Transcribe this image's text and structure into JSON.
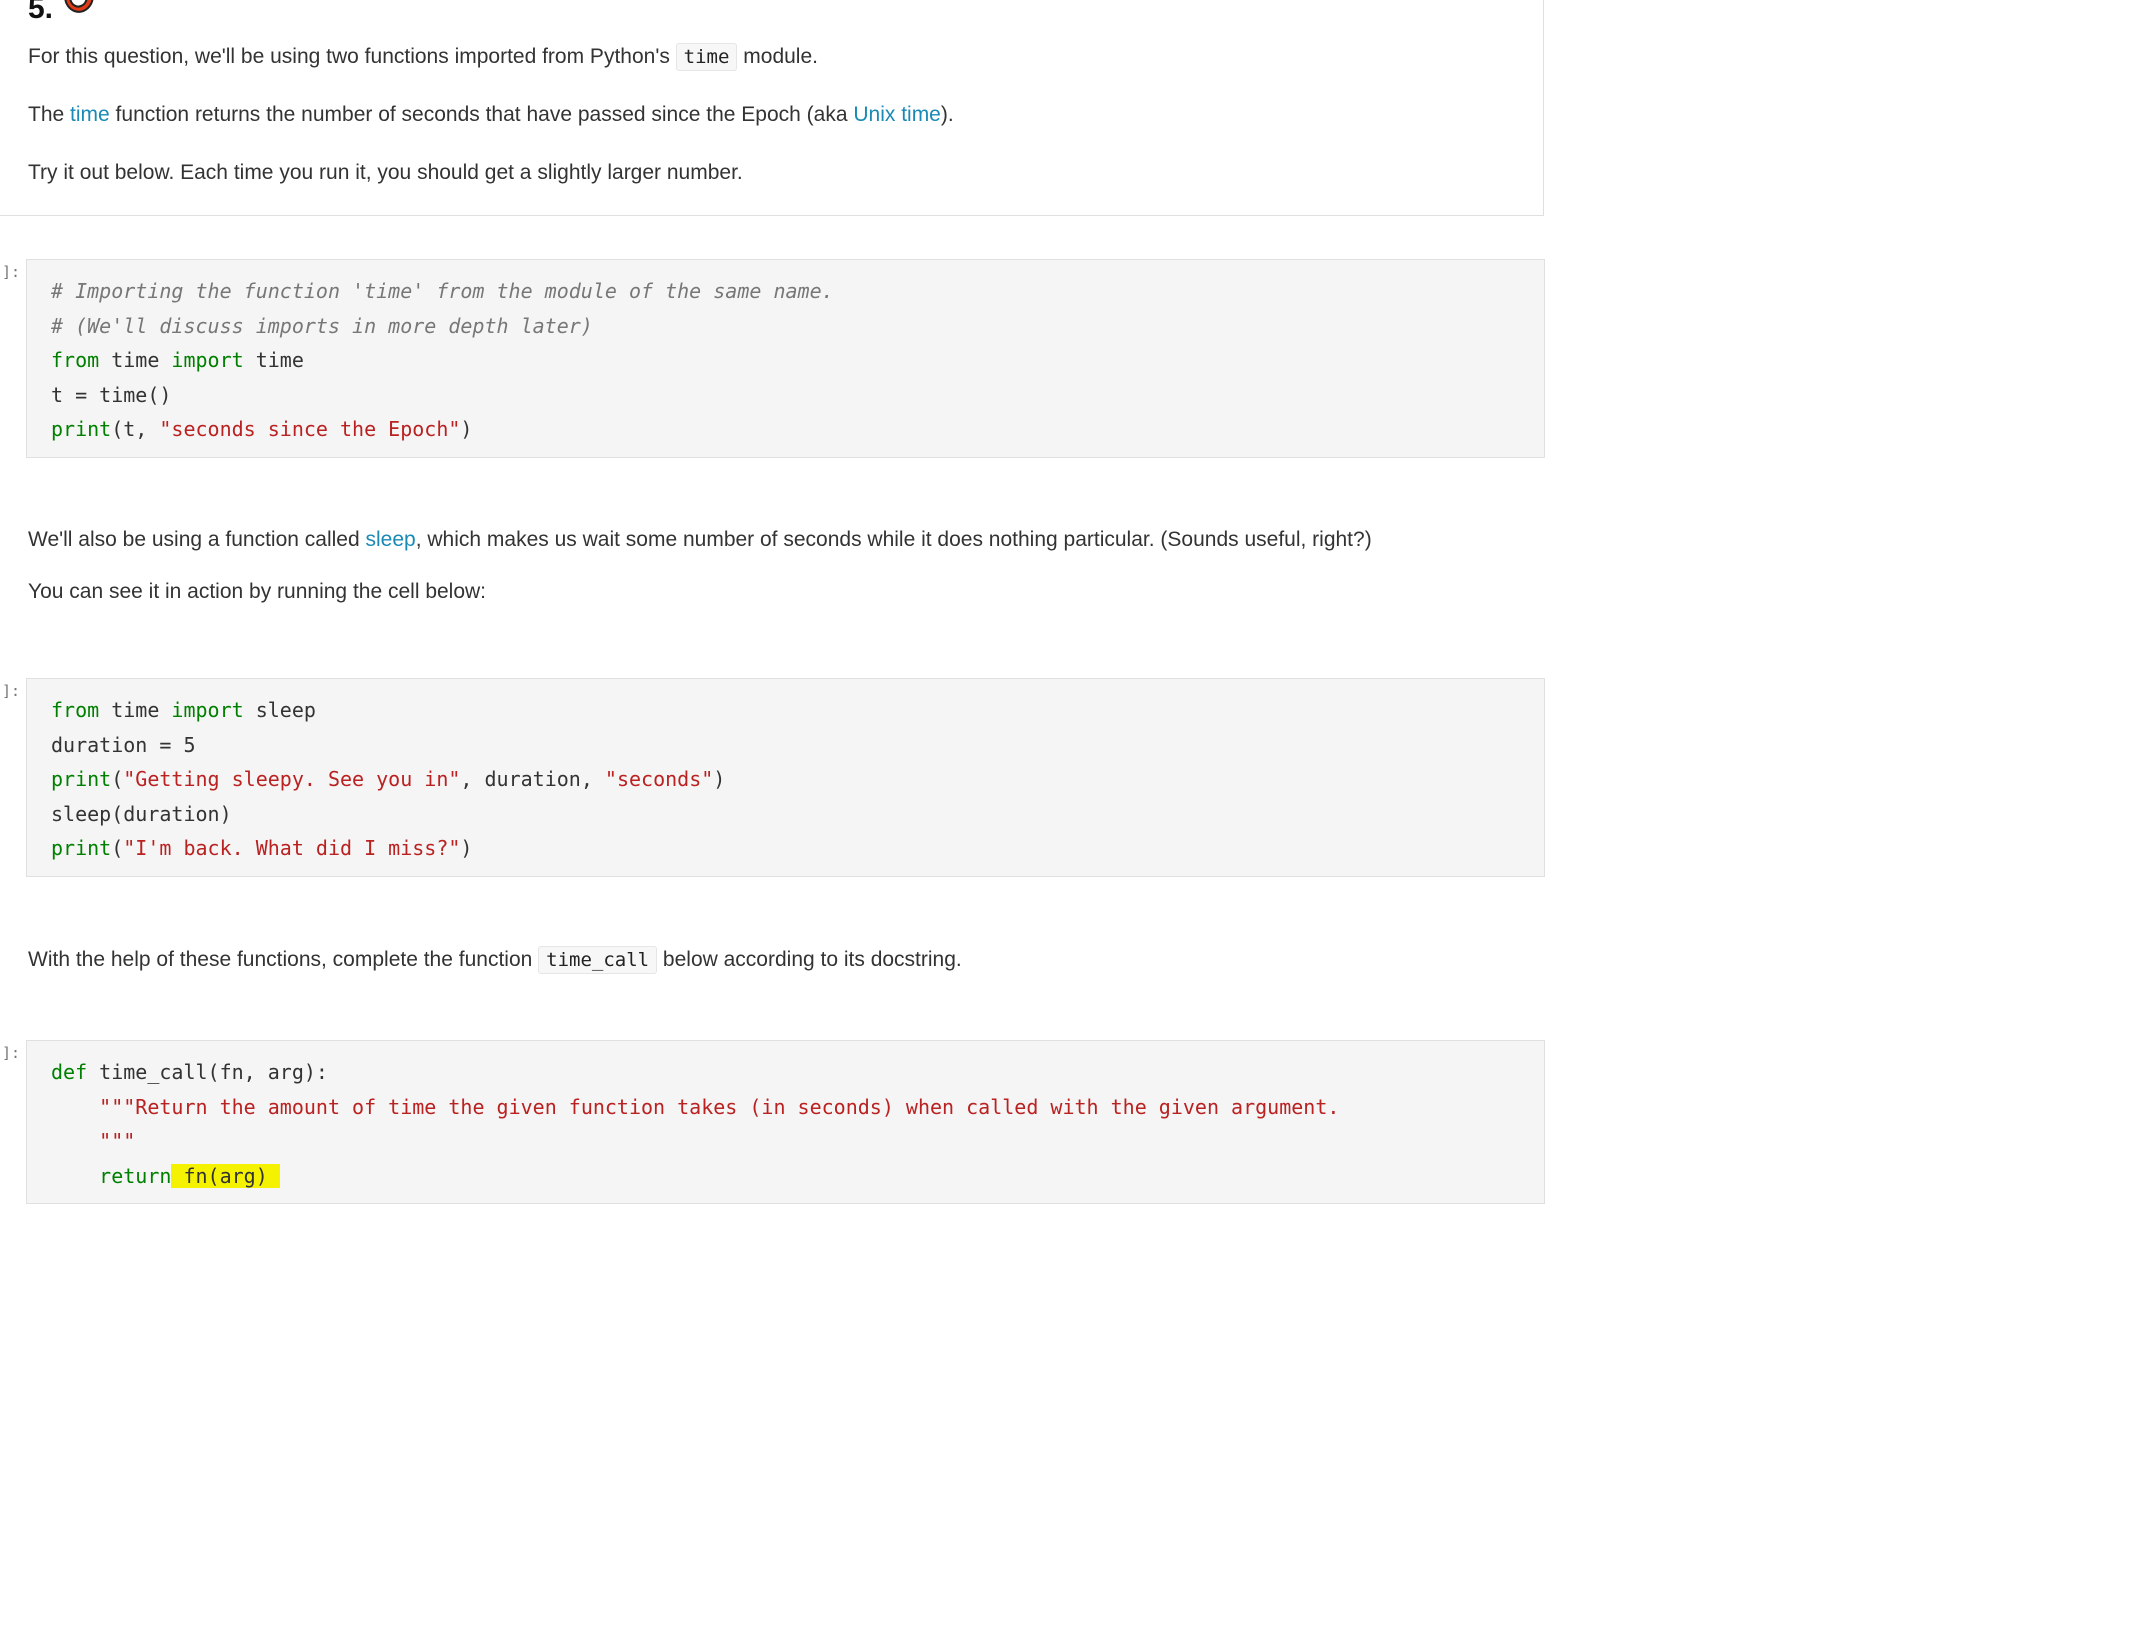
{
  "question": {
    "number": "5.",
    "icon": "chili-pepper-icon"
  },
  "intro": {
    "p1_before": "For this question, we'll be using two functions imported from Python's ",
    "p1_code": "time",
    "p1_after": " module.",
    "p2_before": "The ",
    "p2_link1": "time",
    "p2_middle": " function returns the number of seconds that have passed since the Epoch (aka ",
    "p2_link2": "Unix time",
    "p2_after": ").",
    "p3": "Try it out below. Each time you run it, you should get a slightly larger number."
  },
  "cell1": {
    "prompt": "]:",
    "lines": [
      [
        {
          "t": "# Importing the function 'time' from the module of the same name.",
          "c": "cm"
        }
      ],
      [
        {
          "t": "# (We'll discuss imports in more depth later)",
          "c": "cm"
        }
      ],
      [
        {
          "t": "from",
          "c": "kw"
        },
        {
          "t": " time ",
          "c": ""
        },
        {
          "t": "import",
          "c": "kw"
        },
        {
          "t": " time",
          "c": ""
        }
      ],
      [
        {
          "t": "t = time()",
          "c": ""
        }
      ],
      [
        {
          "t": "print",
          "c": "kw"
        },
        {
          "t": "(t, ",
          "c": ""
        },
        {
          "t": "\"seconds since the Epoch\"",
          "c": "str"
        },
        {
          "t": ")",
          "c": ""
        }
      ]
    ]
  },
  "middle": {
    "p1_before": "We'll also be using a function called ",
    "p1_link": "sleep",
    "p1_after": ", which makes us wait some number of seconds while it does nothing particular. (Sounds useful, right?)",
    "p2": "You can see it in action by running the cell below:"
  },
  "cell2": {
    "prompt": "]:",
    "lines": [
      [
        {
          "t": "from",
          "c": "kw"
        },
        {
          "t": " time ",
          "c": ""
        },
        {
          "t": "import",
          "c": "kw"
        },
        {
          "t": " sleep",
          "c": ""
        }
      ],
      [
        {
          "t": "duration = 5",
          "c": ""
        }
      ],
      [
        {
          "t": "print",
          "c": "kw"
        },
        {
          "t": "(",
          "c": ""
        },
        {
          "t": "\"Getting sleepy. See you in\"",
          "c": "str"
        },
        {
          "t": ", duration, ",
          "c": ""
        },
        {
          "t": "\"seconds\"",
          "c": "str"
        },
        {
          "t": ")",
          "c": ""
        }
      ],
      [
        {
          "t": "sleep(duration)",
          "c": ""
        }
      ],
      [
        {
          "t": "print",
          "c": "kw"
        },
        {
          "t": "(",
          "c": ""
        },
        {
          "t": "\"I'm back. What did I miss?\"",
          "c": "str"
        },
        {
          "t": ")",
          "c": ""
        }
      ]
    ]
  },
  "instruction": {
    "before": "With the help of these functions, complete the function ",
    "code": "time_call",
    "after": " below according to its docstring."
  },
  "cell3": {
    "prompt": "]:",
    "lines": [
      [
        {
          "t": "def",
          "c": "kw"
        },
        {
          "t": " time_call(fn, arg):",
          "c": ""
        }
      ],
      [
        {
          "t": "    ",
          "c": ""
        },
        {
          "t": "\"\"\"Return the amount of time the given function takes (in seconds) when called with the given argument.",
          "c": "str"
        }
      ],
      [
        {
          "t": "    ",
          "c": ""
        },
        {
          "t": "\"\"\"",
          "c": "str"
        }
      ],
      [
        {
          "t": "    ",
          "c": ""
        },
        {
          "t": "return",
          "c": "kw"
        },
        {
          "t": " fn(arg) ",
          "c": "hl"
        }
      ]
    ]
  }
}
